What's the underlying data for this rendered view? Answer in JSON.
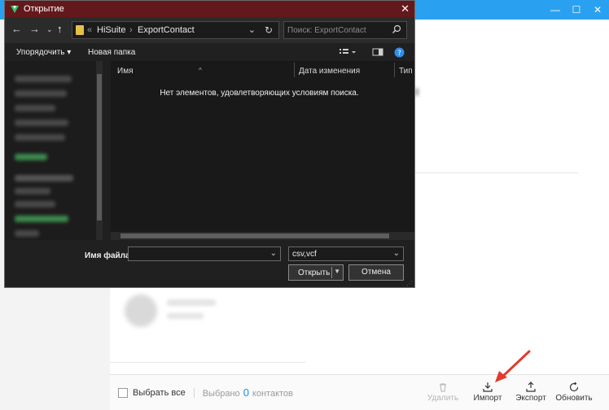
{
  "colors": {
    "app_accent": "#2aa1f0",
    "dialog_titlebar": "#63191b",
    "dialog_bg": "#202020",
    "selected_count": "#1a8fe3",
    "annotation_arrow": "#e23b2e"
  },
  "app": {
    "window_buttons": [
      "—",
      "☐",
      "✕"
    ],
    "bottom_bar": {
      "select_all_label": "Выбрать все",
      "selected_prefix": "Выбрано",
      "selected_count": "0",
      "selected_suffix": "контактов"
    },
    "toolbar": {
      "delete_label": "Удалить",
      "import_label": "Импорт",
      "export_label": "Экспорт",
      "refresh_label": "Обновить"
    }
  },
  "dialog": {
    "title": "Открытие",
    "address": {
      "separator": "«",
      "segments": [
        "HiSuite",
        "ExportContact"
      ],
      "arrow": "›"
    },
    "search_placeholder": "Поиск: ExportContact",
    "commands": {
      "organize": "Упорядочить ▾",
      "new_folder": "Новая папка"
    },
    "columns": {
      "name": "Имя",
      "date_modified": "Дата изменения",
      "type": "Тип"
    },
    "empty_message": "Нет элементов, удовлетворяющих условиям поиска.",
    "file_name_label": "Имя файла:",
    "file_name_value": "",
    "file_type_value": "csv,vcf",
    "open_label": "Открыть",
    "cancel_label": "Отмена"
  }
}
